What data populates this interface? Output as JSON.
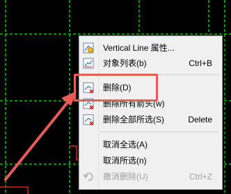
{
  "menu": {
    "items": [
      {
        "label": "Vertical Line 属性...",
        "shortcut": "",
        "icon": "properties-icon",
        "disabled": false
      },
      {
        "label": "对象列表(b)",
        "shortcut": "Ctrl+B",
        "icon": "object-list-icon",
        "disabled": false
      },
      {
        "label": "删除(D)",
        "shortcut": "",
        "icon": "delete-icon",
        "disabled": false
      },
      {
        "label": "删除所有箭头(w)",
        "shortcut": "",
        "icon": "delete-arrows-icon",
        "disabled": false
      },
      {
        "label": "删除全部所选(S)",
        "shortcut": "Delete",
        "icon": "delete-selected-icon",
        "disabled": false
      },
      {
        "label": "取消全选(A)",
        "shortcut": "",
        "icon": "",
        "disabled": false
      },
      {
        "label": "取消所选(n)",
        "shortcut": "",
        "icon": "",
        "disabled": false
      },
      {
        "label": "撤消删除(U)",
        "shortcut": "Ctrl+Z",
        "icon": "undo-icon",
        "disabled": true
      }
    ]
  },
  "colors": {
    "background": "#000000",
    "grid_line": "#00c800",
    "annotation": "#e85b5b",
    "menu_bg": "#f0f0f0"
  }
}
